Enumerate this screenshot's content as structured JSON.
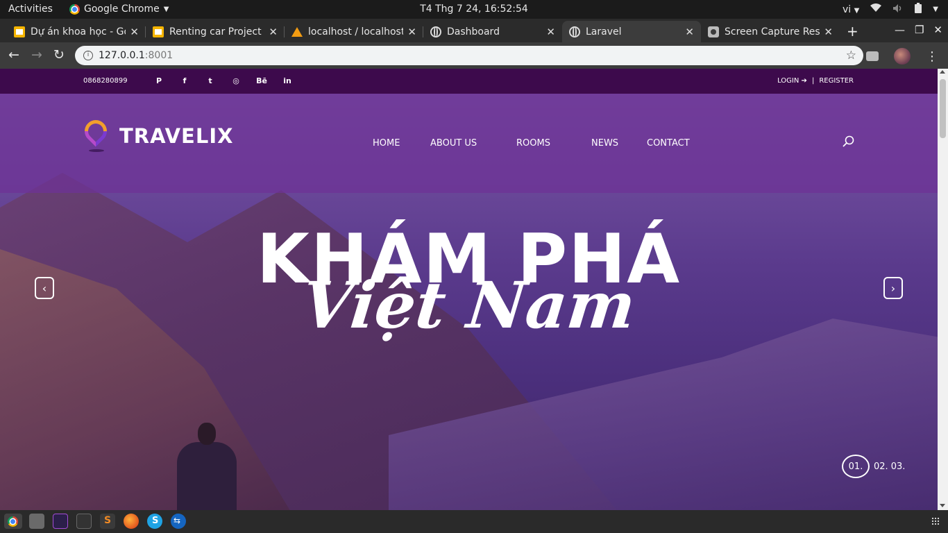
{
  "os": {
    "activities": "Activities",
    "app_name": "Google Chrome",
    "clock": "T4 Thg 7 24, 16:52:54",
    "input_lang": "vi"
  },
  "tabs": [
    {
      "label": "Dự án khoa học - Go",
      "icon": "docs-icon"
    },
    {
      "label": "Renting car Project",
      "icon": "slides-icon"
    },
    {
      "label": "localhost / localhost",
      "icon": "phpmyadmin-icon"
    },
    {
      "label": "Dashboard",
      "icon": "globe-icon"
    },
    {
      "label": "Laravel",
      "icon": "globe-icon",
      "active": true
    },
    {
      "label": "Screen Capture Res",
      "icon": "camera-icon"
    }
  ],
  "address": {
    "host": "127.0.0.1",
    "port": ":8001"
  },
  "site": {
    "phone": "0868280899",
    "socials": [
      "pinterest-icon",
      "facebook-icon",
      "twitter-icon",
      "instagram-icon",
      "behance-icon",
      "linkedin-icon"
    ],
    "social_glyphs": [
      "P",
      "f",
      "t",
      "◎",
      "Bē",
      "in"
    ],
    "login": "LOGIN",
    "separator": "|",
    "register": "REGISTER",
    "brand": "TRAVELIX",
    "nav": [
      "HOME",
      "ABOUT US",
      "ROOMS",
      "NEWS",
      "CONTACT"
    ],
    "hero_line1": "KHÁM PHÁ",
    "hero_line2": "Việt Nam",
    "slides": [
      "01.",
      "02.",
      "03."
    ]
  },
  "colors": {
    "top_bar": "#3d0a4c",
    "header_overlay": "#6e3296",
    "logo_orange": "#f29f2c",
    "logo_purple": "#b64acb"
  }
}
